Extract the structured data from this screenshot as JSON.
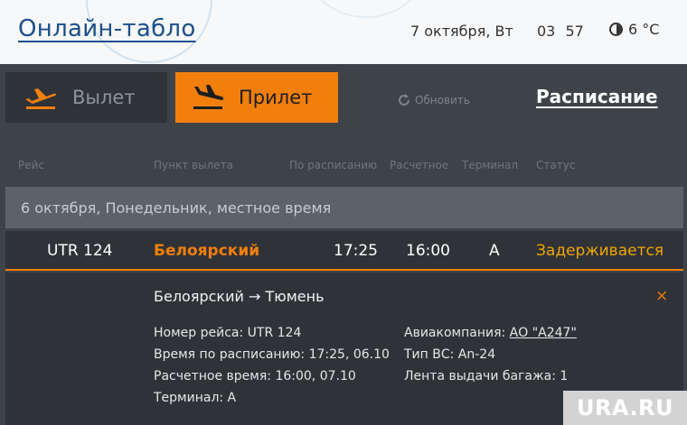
{
  "header": {
    "title": "Онлайн-табло",
    "date": "7 октября, Вт",
    "time": "03 57",
    "temperature": "6 °C"
  },
  "mode_tabs": [
    {
      "label": "Вылет",
      "icon": "plane-takeoff-icon",
      "active": false
    },
    {
      "label": "Прилет",
      "icon": "plane-landing-icon",
      "active": true
    }
  ],
  "refresh_label": "Обновить",
  "schedule_link": "Расписание",
  "columns": [
    "Рейс",
    "Пункт вылета",
    "По расписанию",
    "Расчетное",
    "Терминал",
    "Статус"
  ],
  "date_group": "6 октября, Понедельник, местное время",
  "flight": {
    "number": "UTR 124",
    "origin": "Белоярский",
    "scheduled": "17:25",
    "estimated": "16:00",
    "terminal": "A",
    "status": "Задерживается"
  },
  "details": {
    "route": "Белоярский → Тюмень",
    "flight_number": "Номер рейса: UTR 124",
    "scheduled_time": "Время по расписанию: 17:25, 06.10",
    "estimated_time": "Расчетное время: 16:00, 07.10",
    "terminal": "Терминал: A",
    "airline_label": "Авиакомпания: ",
    "airline": "АО \"А247\"",
    "aircraft_type": "Тип ВС: An-24",
    "baggage_belt": "Лента выдачи багажа: 1",
    "close_symbol": "×"
  },
  "watermark": "URA.RU",
  "colors": {
    "accent": "#f27f0c",
    "status_delayed": "#f0a500",
    "link": "#1d4f8c"
  }
}
